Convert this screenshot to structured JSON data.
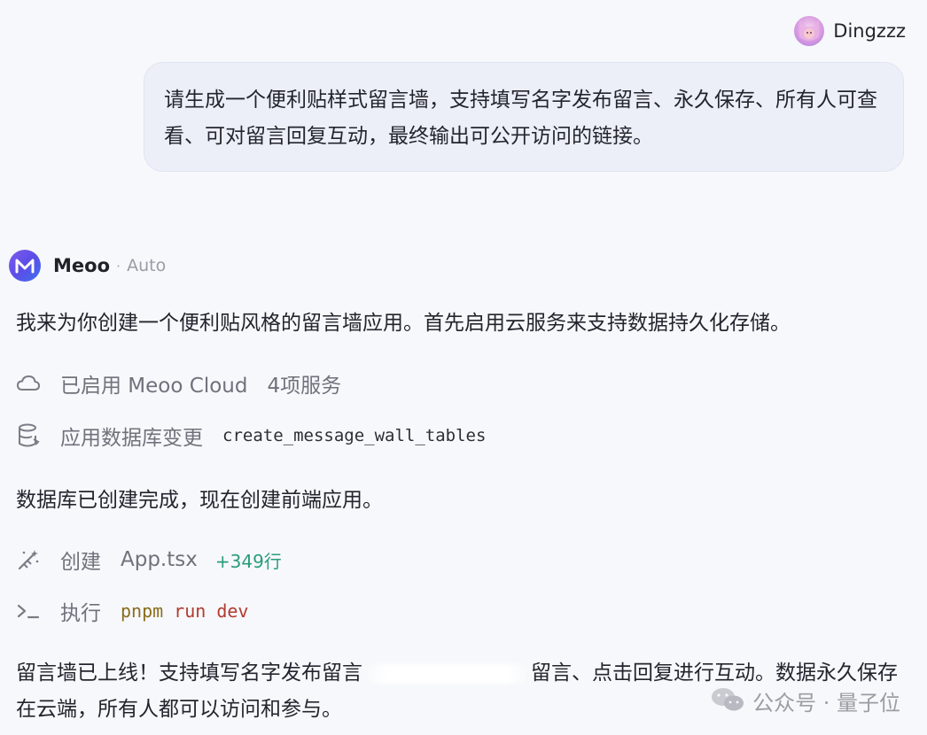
{
  "user": {
    "name": "Dingzzz",
    "message": "请生成一个便利贴样式留言墙，支持填写名字发布留言、永久保存、所有人可查看、可对留言回复互动，最终输出可公开访问的链接。"
  },
  "assistant": {
    "name": "Meoo",
    "separator": "·",
    "mode": "Auto",
    "intro": "我来为你创建一个便利贴风格的留言墙应用。首先启用云服务来支持数据持久化存储。",
    "cloud_step": {
      "icon": "cloud-icon",
      "label": "已启用 Meoo Cloud",
      "detail": "4项服务"
    },
    "db_step": {
      "icon": "database-icon",
      "label": "应用数据库变更",
      "detail": "create_message_wall_tables"
    },
    "mid_text": "数据库已创建完成，现在创建前端应用。",
    "create_step": {
      "icon": "magic-wand-icon",
      "label": "创建",
      "file": "App.tsx",
      "added": "+349行"
    },
    "run_step": {
      "icon": "terminal-icon",
      "label": "执行",
      "cmd": "pnpm",
      "args": "run dev"
    },
    "final_text_a": "留言墙已上线！支持填写名字发布留言",
    "final_text_b": "留言、点击回复进行互动。数据永久保存在云端，所有人都可以访问和参与。"
  },
  "watermark": {
    "text": "公众号 · 量子位",
    "icon": "wechat-icon"
  },
  "colors": {
    "bubble_bg": "#eceef8",
    "added_lines": "#2a9d78",
    "cmd": "#8a6d1d",
    "cmd_args": "#b23b2f"
  }
}
